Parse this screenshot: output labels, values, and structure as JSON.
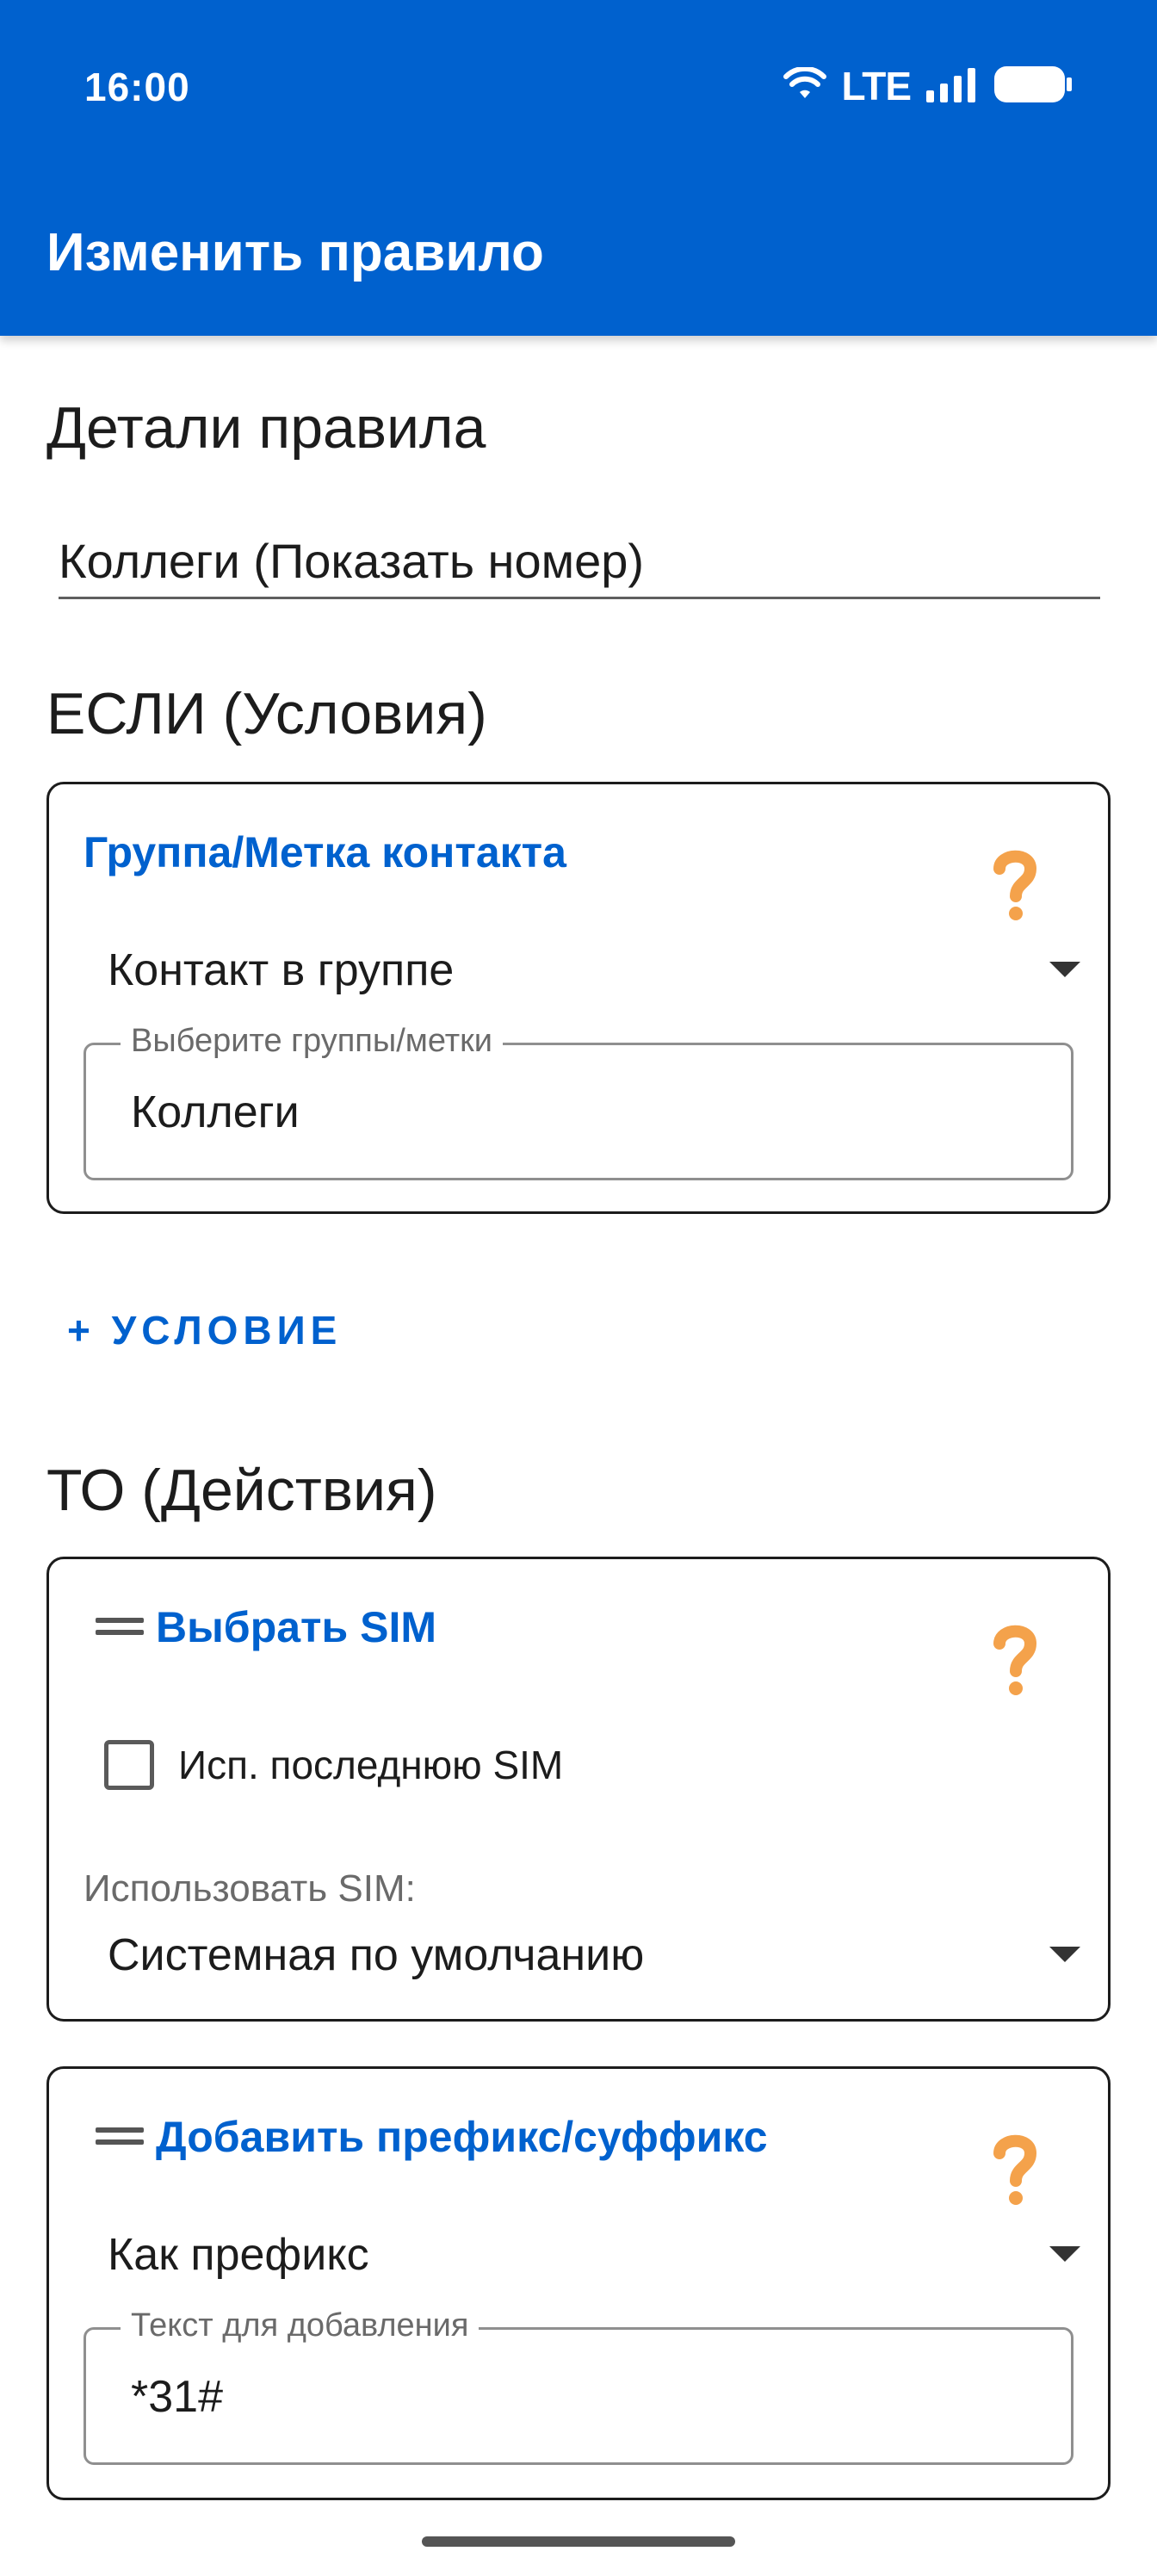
{
  "status_bar": {
    "time": "16:00",
    "network": "LTE",
    "icons": [
      "wifi-icon",
      "signal-icon",
      "battery-icon"
    ]
  },
  "app_bar": {
    "title": "Изменить правило",
    "background_color": "#0061CE"
  },
  "details": {
    "heading": "Детали правила",
    "rule_name_value": "Коллеги (Показать номер)"
  },
  "conditions": {
    "heading": "ЕСЛИ (Условия)",
    "cards": [
      {
        "title": "Группа/Метка контакта",
        "dropdown_value": "Контакт в группе",
        "field_label": "Выберите группы/метки",
        "field_value": "Коллеги"
      }
    ],
    "add_label": "+ УСЛОВИЕ"
  },
  "actions": {
    "heading": "ТО (Действия)",
    "cards": [
      {
        "title": "Выбрать SIM",
        "checkbox_label": "Исп. последнюю SIM",
        "checkbox_checked": false,
        "select_label": "Использовать SIM:",
        "select_value": "Системная по умолчанию"
      },
      {
        "title": "Добавить префикс/суффикс",
        "dropdown_value": "Как префикс",
        "field_label": "Текст для добавления",
        "field_value": "*31#"
      }
    ]
  },
  "colors": {
    "accent": "#0061CE",
    "help_icon": "#F4A24B"
  }
}
